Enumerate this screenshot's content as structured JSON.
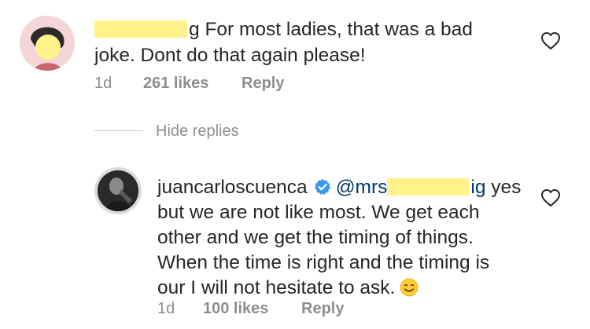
{
  "comment": {
    "username_visible_fragment": "g",
    "line1_text": "For most ladies, that was a bad",
    "line2_text": "joke. Dont do that again please!",
    "time": "1d",
    "likes": "261 likes",
    "reply_label": "Reply"
  },
  "hide_replies_label": "Hide replies",
  "reply": {
    "username": "juancarloscuenca",
    "mention_visible": "@mrs",
    "mention_tail": "ig",
    "line1_rest": "yes",
    "line2": "but we are not like most. We get each",
    "line3": "other and we get the timing of things.",
    "line4": "When the time is right and the timing is",
    "line5": "our I will not hesitate to ask.",
    "time": "1d",
    "likes": "100 likes",
    "reply_label": "Reply"
  },
  "colors": {
    "text": "#262626",
    "meta": "#8e8e8e",
    "verified": "#3897f0",
    "redaction": "#fff28a",
    "mention": "#00376b"
  },
  "icons": {
    "like": "heart-outline-icon",
    "verified": "verified-badge-icon",
    "emoji": "smiling-face-emoji-icon"
  }
}
